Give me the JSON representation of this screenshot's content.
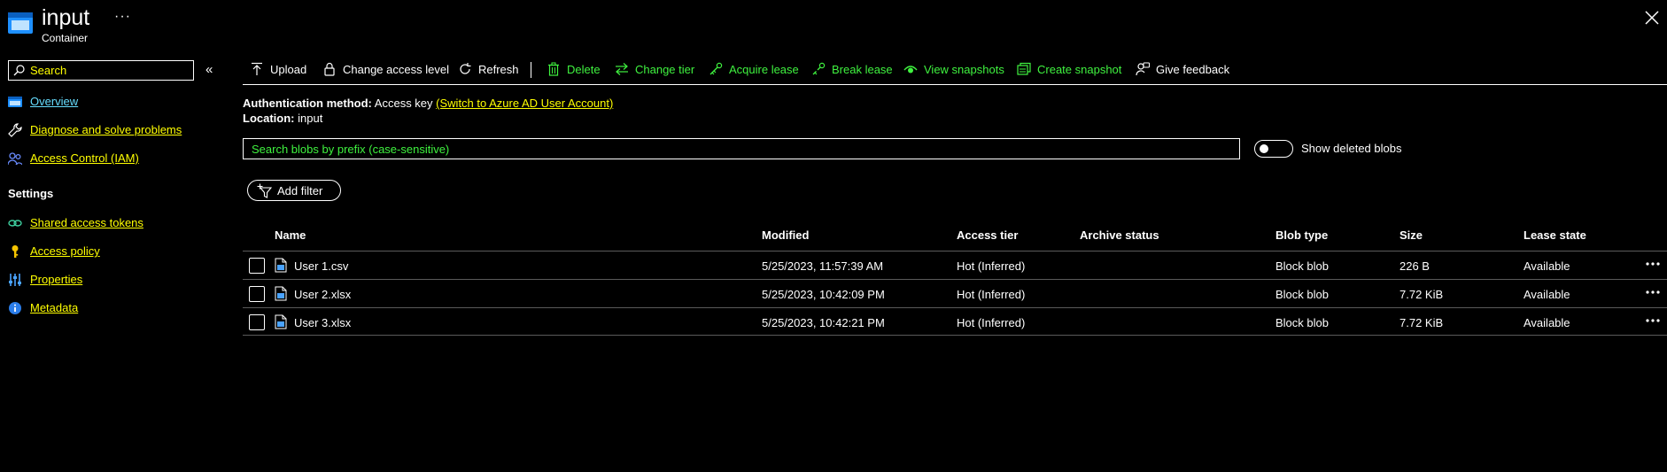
{
  "header": {
    "title": "input",
    "subtitle": "Container",
    "more": "···"
  },
  "sidebar": {
    "search_placeholder": "Search",
    "collapse": "«",
    "items": [
      {
        "label": "Overview",
        "icon": "container-icon"
      },
      {
        "label": "Diagnose and solve problems",
        "icon": "wrench-icon"
      },
      {
        "label": "Access Control (IAM)",
        "icon": "people-icon"
      }
    ],
    "settings_label": "Settings",
    "settings_items": [
      {
        "label": "Shared access tokens",
        "icon": "link-icon"
      },
      {
        "label": "Access policy",
        "icon": "key-icon"
      },
      {
        "label": "Properties",
        "icon": "sliders-icon"
      },
      {
        "label": "Metadata",
        "icon": "info-icon"
      }
    ]
  },
  "toolbar": {
    "upload": "Upload",
    "change_access": "Change access level",
    "refresh": "Refresh",
    "delete": "Delete",
    "change_tier": "Change tier",
    "acquire_lease": "Acquire lease",
    "break_lease": "Break lease",
    "view_snapshots": "View snapshots",
    "create_snapshot": "Create snapshot",
    "give_feedback": "Give feedback"
  },
  "info": {
    "auth_label": "Authentication method:",
    "auth_value": "Access key",
    "auth_link": "(Switch to Azure AD User Account)",
    "location_label": "Location:",
    "location_value": "input"
  },
  "blob_search": {
    "placeholder": "Search blobs by prefix (case-sensitive)"
  },
  "show_deleted": {
    "label": "Show deleted blobs",
    "on": false
  },
  "add_filter": "Add filter",
  "table": {
    "headers": {
      "name": "Name",
      "modified": "Modified",
      "access_tier": "Access tier",
      "archive_status": "Archive status",
      "blob_type": "Blob type",
      "size": "Size",
      "lease_state": "Lease state"
    },
    "rows": [
      {
        "name": "User 1.csv",
        "modified": "5/25/2023, 11:57:39 AM",
        "access_tier": "Hot (Inferred)",
        "archive_status": "",
        "blob_type": "Block blob",
        "size": "226 B",
        "lease_state": "Available"
      },
      {
        "name": "User 2.xlsx",
        "modified": "5/25/2023, 10:42:09 PM",
        "access_tier": "Hot (Inferred)",
        "archive_status": "",
        "blob_type": "Block blob",
        "size": "7.72 KiB",
        "lease_state": "Available"
      },
      {
        "name": "User 3.xlsx",
        "modified": "5/25/2023, 10:42:21 PM",
        "access_tier": "Hot (Inferred)",
        "archive_status": "",
        "blob_type": "Block blob",
        "size": "7.72 KiB",
        "lease_state": "Available"
      }
    ]
  },
  "colors": {
    "background": "#000000",
    "text": "#ffffff",
    "link": "#ffff00",
    "action": "#3ff23f",
    "active": "#66ddff"
  }
}
